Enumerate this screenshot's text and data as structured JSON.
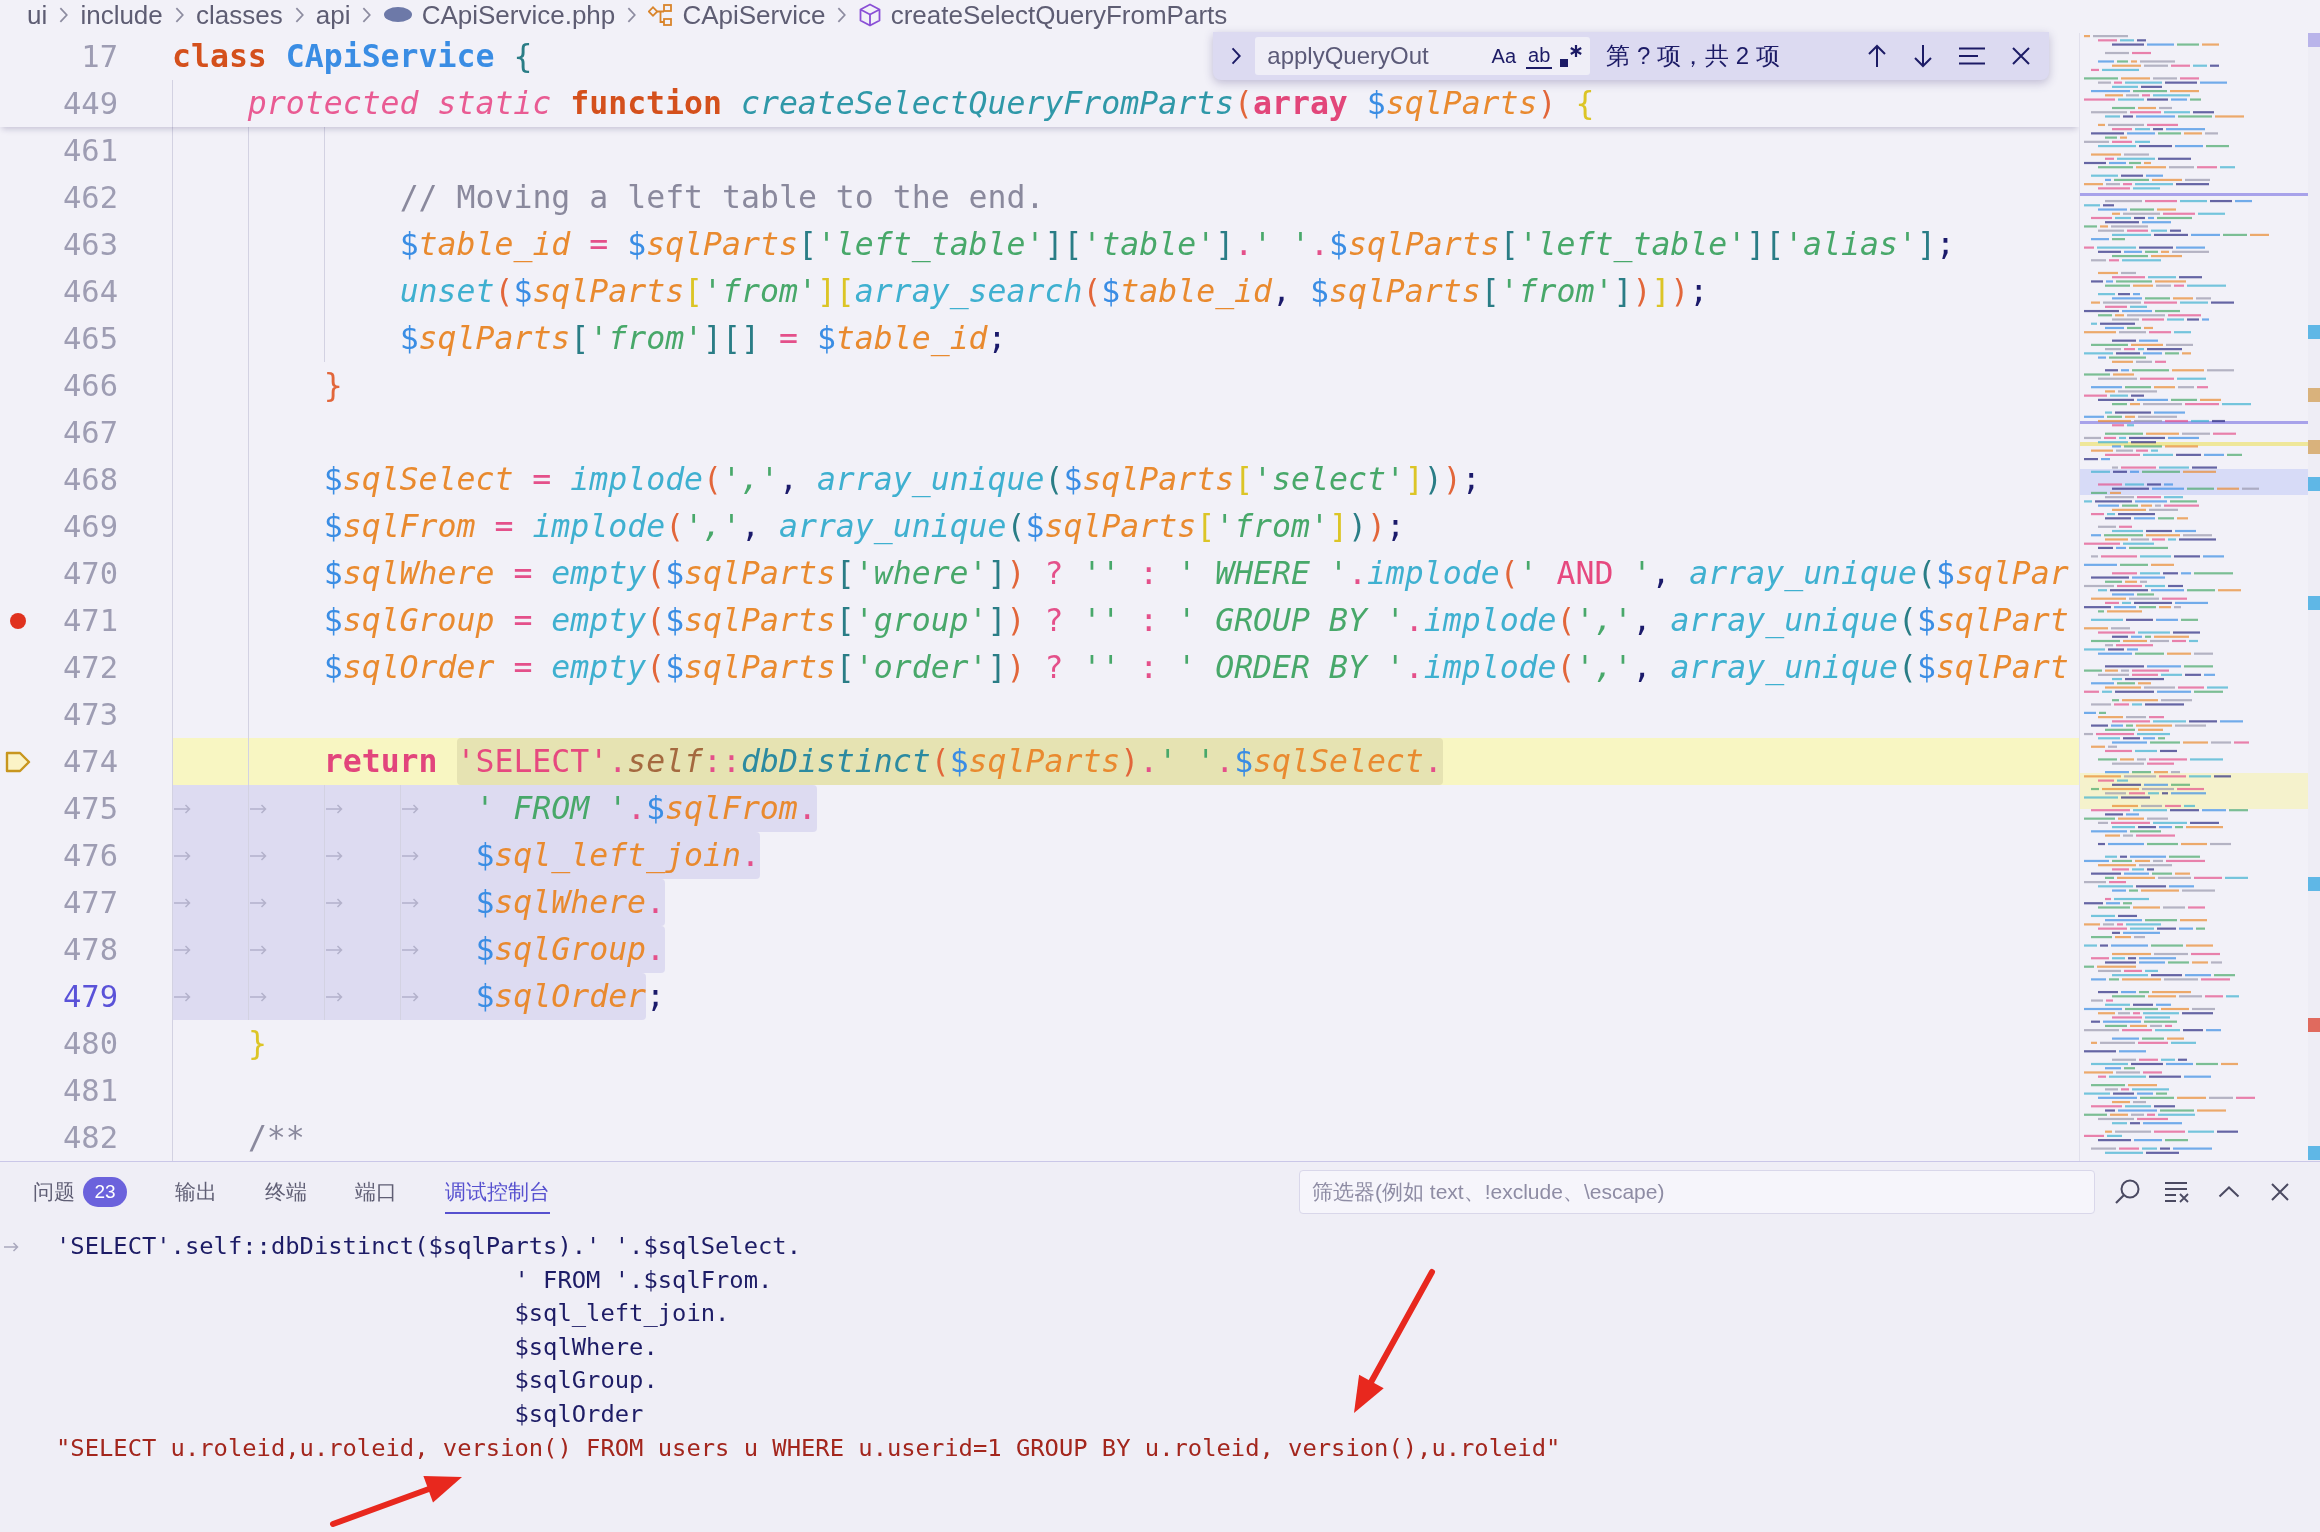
{
  "breadcrumb": [
    {
      "kind": "folder",
      "label": "ui"
    },
    {
      "kind": "folder",
      "label": "include"
    },
    {
      "kind": "folder",
      "label": "classes"
    },
    {
      "kind": "folder",
      "label": "api"
    },
    {
      "kind": "file",
      "label": "CApiService.php"
    },
    {
      "kind": "class",
      "label": "CApiService"
    },
    {
      "kind": "method",
      "label": "createSelectQueryFromParts"
    }
  ],
  "find_widget": {
    "value": "applyQueryOut",
    "options": [
      {
        "kind": "match-case",
        "label": "Aa"
      },
      {
        "kind": "whole-word",
        "label": "ab"
      },
      {
        "kind": "regex"
      }
    ],
    "result": "第 ? 项，共 2 项"
  },
  "editor": {
    "sticky_lines": [
      {
        "number": "17",
        "tokens": [
          {
            "text": "class ",
            "kind": "keyword"
          },
          {
            "text": "CApiService ",
            "kind": "class-name"
          },
          {
            "text": "{",
            "kind": "bracket-2"
          }
        ]
      },
      {
        "number": "449",
        "tokens": [
          {
            "text": "    protected static ",
            "kind": "modifier"
          },
          {
            "text": "function ",
            "kind": "keyword"
          },
          {
            "text": "createSelectQueryFromParts",
            "kind": "function-name"
          },
          {
            "text": "(",
            "kind": "bracket-1"
          },
          {
            "text": "array ",
            "kind": "type"
          },
          {
            "text": "$sqlParts",
            "kind": "variable"
          },
          {
            "text": ") ",
            "kind": "bracket-1"
          },
          {
            "text": "{",
            "kind": "bracket-3"
          }
        ]
      }
    ],
    "lines": [
      {
        "number": "461",
        "breakpoint": false,
        "paused": false,
        "cursor": false
      },
      {
        "number": "462",
        "breakpoint": false,
        "paused": false,
        "cursor": false,
        "parts": [
          {
            "selected": false,
            "tokens": [
              {
                "text": "            // Moving a left table to the end.",
                "kind": "comment"
              }
            ]
          }
        ]
      },
      {
        "number": "463",
        "breakpoint": false,
        "paused": false,
        "cursor": false,
        "parts": [
          {
            "selected": false,
            "tokens": [
              {
                "text": "            $table_id",
                "kind": "variable"
              },
              {
                "text": " = ",
                "kind": "operator"
              },
              {
                "text": "$sqlParts",
                "kind": "variable"
              },
              {
                "text": "[",
                "kind": "bracket-2"
              },
              {
                "text": "'left_table'",
                "kind": "string"
              },
              {
                "text": "][",
                "kind": "bracket-2"
              },
              {
                "text": "'table'",
                "kind": "string"
              },
              {
                "text": "]",
                "kind": "bracket-2"
              },
              {
                "text": ".",
                "kind": "operator"
              },
              {
                "text": "' '",
                "kind": "string"
              },
              {
                "text": ".",
                "kind": "operator"
              },
              {
                "text": "$sqlParts",
                "kind": "variable"
              },
              {
                "text": "[",
                "kind": "bracket-2"
              },
              {
                "text": "'left_table'",
                "kind": "string"
              },
              {
                "text": "][",
                "kind": "bracket-2"
              },
              {
                "text": "'alias'",
                "kind": "string"
              },
              {
                "text": "]",
                "kind": "bracket-2"
              },
              {
                "text": ";",
                "kind": "punctuation"
              }
            ]
          }
        ]
      },
      {
        "number": "464",
        "breakpoint": false,
        "paused": false,
        "cursor": false,
        "parts": [
          {
            "selected": false,
            "tokens": [
              {
                "text": "            unset",
                "kind": "call"
              },
              {
                "text": "(",
                "kind": "bracket-1"
              },
              {
                "text": "$sqlParts",
                "kind": "variable"
              },
              {
                "text": "[",
                "kind": "bracket-3"
              },
              {
                "text": "'from'",
                "kind": "string"
              },
              {
                "text": "][",
                "kind": "bracket-3"
              },
              {
                "text": "array_search",
                "kind": "call"
              },
              {
                "text": "(",
                "kind": "bracket-1"
              },
              {
                "text": "$table_id",
                "kind": "variable"
              },
              {
                "text": ", ",
                "kind": "punctuation"
              },
              {
                "text": "$sqlParts",
                "kind": "variable"
              },
              {
                "text": "[",
                "kind": "bracket-2"
              },
              {
                "text": "'from'",
                "kind": "string"
              },
              {
                "text": "]",
                "kind": "bracket-2"
              },
              {
                "text": ")",
                "kind": "bracket-1"
              },
              {
                "text": "]",
                "kind": "bracket-3"
              },
              {
                "text": ")",
                "kind": "bracket-1"
              },
              {
                "text": ";",
                "kind": "punctuation"
              }
            ]
          }
        ]
      },
      {
        "number": "465",
        "breakpoint": false,
        "paused": false,
        "cursor": false,
        "parts": [
          {
            "selected": false,
            "tokens": [
              {
                "text": "            $sqlParts",
                "kind": "variable"
              },
              {
                "text": "[",
                "kind": "bracket-2"
              },
              {
                "text": "'from'",
                "kind": "string"
              },
              {
                "text": "][]",
                "kind": "bracket-2"
              },
              {
                "text": " = ",
                "kind": "operator"
              },
              {
                "text": "$table_id",
                "kind": "variable"
              },
              {
                "text": ";",
                "kind": "punctuation"
              }
            ]
          }
        ]
      },
      {
        "number": "466",
        "breakpoint": false,
        "paused": false,
        "cursor": false,
        "parts": [
          {
            "selected": false,
            "tokens": [
              {
                "text": "        }",
                "kind": "bracket-1"
              }
            ]
          }
        ]
      },
      {
        "number": "467",
        "breakpoint": false,
        "paused": false,
        "cursor": false
      },
      {
        "number": "468",
        "breakpoint": false,
        "paused": false,
        "cursor": false,
        "parts": [
          {
            "selected": false,
            "tokens": [
              {
                "text": "        $sqlSelect",
                "kind": "variable"
              },
              {
                "text": " = ",
                "kind": "operator"
              },
              {
                "text": "implode",
                "kind": "call"
              },
              {
                "text": "(",
                "kind": "bracket-1"
              },
              {
                "text": "','",
                "kind": "string"
              },
              {
                "text": ", ",
                "kind": "punctuation"
              },
              {
                "text": "array_unique",
                "kind": "call"
              },
              {
                "text": "(",
                "kind": "bracket-2"
              },
              {
                "text": "$sqlParts",
                "kind": "variable"
              },
              {
                "text": "[",
                "kind": "bracket-3"
              },
              {
                "text": "'select'",
                "kind": "string"
              },
              {
                "text": "]",
                "kind": "bracket-3"
              },
              {
                "text": ")",
                "kind": "bracket-2"
              },
              {
                "text": ")",
                "kind": "bracket-1"
              },
              {
                "text": ";",
                "kind": "punctuation"
              }
            ]
          }
        ]
      },
      {
        "number": "469",
        "breakpoint": false,
        "paused": false,
        "cursor": false,
        "parts": [
          {
            "selected": false,
            "tokens": [
              {
                "text": "        $sqlFrom",
                "kind": "variable"
              },
              {
                "text": " = ",
                "kind": "operator"
              },
              {
                "text": "implode",
                "kind": "call"
              },
              {
                "text": "(",
                "kind": "bracket-1"
              },
              {
                "text": "','",
                "kind": "string"
              },
              {
                "text": ", ",
                "kind": "punctuation"
              },
              {
                "text": "array_unique",
                "kind": "call"
              },
              {
                "text": "(",
                "kind": "bracket-2"
              },
              {
                "text": "$sqlParts",
                "kind": "variable"
              },
              {
                "text": "[",
                "kind": "bracket-3"
              },
              {
                "text": "'from'",
                "kind": "string"
              },
              {
                "text": "]",
                "kind": "bracket-3"
              },
              {
                "text": ")",
                "kind": "bracket-2"
              },
              {
                "text": ")",
                "kind": "bracket-1"
              },
              {
                "text": ";",
                "kind": "punctuation"
              }
            ]
          }
        ]
      },
      {
        "number": "470",
        "breakpoint": false,
        "paused": false,
        "cursor": false,
        "parts": [
          {
            "selected": false,
            "tokens": [
              {
                "text": "        $sqlWhere",
                "kind": "variable"
              },
              {
                "text": " = ",
                "kind": "operator"
              },
              {
                "text": "empty",
                "kind": "call"
              },
              {
                "text": "(",
                "kind": "bracket-1"
              },
              {
                "text": "$sqlParts",
                "kind": "variable"
              },
              {
                "text": "[",
                "kind": "bracket-2"
              },
              {
                "text": "'where'",
                "kind": "string"
              },
              {
                "text": "]",
                "kind": "bracket-2"
              },
              {
                "text": ")",
                "kind": "bracket-1"
              },
              {
                "text": " ? ",
                "kind": "operator"
              },
              {
                "text": "''",
                "kind": "string"
              },
              {
                "text": " : ",
                "kind": "operator"
              },
              {
                "text": "' WHERE '",
                "kind": "string"
              },
              {
                "text": ".",
                "kind": "operator"
              },
              {
                "text": "implode",
                "kind": "call"
              },
              {
                "text": "(",
                "kind": "bracket-1"
              },
              {
                "text": "' ",
                "kind": "string"
              },
              {
                "text": "AND",
                "kind": "sql"
              },
              {
                "text": " '",
                "kind": "string"
              },
              {
                "text": ", ",
                "kind": "punctuation"
              },
              {
                "text": "array_unique",
                "kind": "call"
              },
              {
                "text": "(",
                "kind": "bracket-2"
              },
              {
                "text": "$sqlPar",
                "kind": "variable"
              }
            ]
          }
        ]
      },
      {
        "number": "471",
        "breakpoint": true,
        "paused": false,
        "cursor": false,
        "parts": [
          {
            "selected": false,
            "tokens": [
              {
                "text": "        $sqlGroup",
                "kind": "variable"
              },
              {
                "text": " = ",
                "kind": "operator"
              },
              {
                "text": "empty",
                "kind": "call"
              },
              {
                "text": "(",
                "kind": "bracket-1"
              },
              {
                "text": "$sqlParts",
                "kind": "variable"
              },
              {
                "text": "[",
                "kind": "bracket-2"
              },
              {
                "text": "'group'",
                "kind": "string"
              },
              {
                "text": "]",
                "kind": "bracket-2"
              },
              {
                "text": ")",
                "kind": "bracket-1"
              },
              {
                "text": " ? ",
                "kind": "operator"
              },
              {
                "text": "''",
                "kind": "string"
              },
              {
                "text": " : ",
                "kind": "operator"
              },
              {
                "text": "' GROUP BY '",
                "kind": "string"
              },
              {
                "text": ".",
                "kind": "operator"
              },
              {
                "text": "implode",
                "kind": "call"
              },
              {
                "text": "(",
                "kind": "bracket-1"
              },
              {
                "text": "','",
                "kind": "string"
              },
              {
                "text": ", ",
                "kind": "punctuation"
              },
              {
                "text": "array_unique",
                "kind": "call"
              },
              {
                "text": "(",
                "kind": "bracket-2"
              },
              {
                "text": "$sqlPart",
                "kind": "variable"
              }
            ]
          }
        ]
      },
      {
        "number": "472",
        "breakpoint": false,
        "paused": false,
        "cursor": false,
        "parts": [
          {
            "selected": false,
            "tokens": [
              {
                "text": "        $sqlOrder",
                "kind": "variable"
              },
              {
                "text": " = ",
                "kind": "operator"
              },
              {
                "text": "empty",
                "kind": "call"
              },
              {
                "text": "(",
                "kind": "bracket-1"
              },
              {
                "text": "$sqlParts",
                "kind": "variable"
              },
              {
                "text": "[",
                "kind": "bracket-2"
              },
              {
                "text": "'order'",
                "kind": "string"
              },
              {
                "text": "]",
                "kind": "bracket-2"
              },
              {
                "text": ")",
                "kind": "bracket-1"
              },
              {
                "text": " ? ",
                "kind": "operator"
              },
              {
                "text": "''",
                "kind": "string"
              },
              {
                "text": " : ",
                "kind": "operator"
              },
              {
                "text": "' ORDER BY '",
                "kind": "string"
              },
              {
                "text": ".",
                "kind": "operator"
              },
              {
                "text": "implode",
                "kind": "call"
              },
              {
                "text": "(",
                "kind": "bracket-1"
              },
              {
                "text": "','",
                "kind": "string"
              },
              {
                "text": ", ",
                "kind": "punctuation"
              },
              {
                "text": "array_unique",
                "kind": "call"
              },
              {
                "text": "(",
                "kind": "bracket-2"
              },
              {
                "text": "$sqlPart",
                "kind": "variable"
              }
            ]
          }
        ]
      },
      {
        "number": "473",
        "breakpoint": false,
        "paused": false,
        "cursor": false
      },
      {
        "number": "474",
        "breakpoint": false,
        "paused": true,
        "cursor": false,
        "parts": [
          {
            "selected": false,
            "tokens": [
              {
                "text": "        return ",
                "kind": "return"
              }
            ]
          },
          {
            "selected": true,
            "tokens": [
              {
                "text": "'SELECT'",
                "kind": "sql"
              },
              {
                "text": ".",
                "kind": "operator"
              },
              {
                "text": "self",
                "kind": "self"
              },
              {
                "text": "::",
                "kind": "operator"
              },
              {
                "text": "dbDistinct",
                "kind": "method"
              },
              {
                "text": "(",
                "kind": "bracket-1"
              },
              {
                "text": "$sqlParts",
                "kind": "variable"
              },
              {
                "text": ")",
                "kind": "bracket-1"
              },
              {
                "text": ".",
                "kind": "operator"
              },
              {
                "text": "' '",
                "kind": "string"
              },
              {
                "text": ".",
                "kind": "operator"
              },
              {
                "text": "$sqlSelect",
                "kind": "variable"
              },
              {
                "text": ".",
                "kind": "operator"
              }
            ]
          }
        ]
      },
      {
        "number": "475",
        "breakpoint": false,
        "paused": false,
        "cursor": false,
        "parts": [
          {
            "selected": true,
            "tokens": [
              {
                "text": "\t\t\t\t' FROM '",
                "kind": "string"
              },
              {
                "text": ".",
                "kind": "operator"
              },
              {
                "text": "$sqlFrom",
                "kind": "variable"
              },
              {
                "text": ".",
                "kind": "operator"
              }
            ]
          }
        ]
      },
      {
        "number": "476",
        "breakpoint": false,
        "paused": false,
        "cursor": false,
        "parts": [
          {
            "selected": true,
            "tokens": [
              {
                "text": "\t\t\t\t$sql_left_join",
                "kind": "variable"
              },
              {
                "text": ".",
                "kind": "operator"
              }
            ]
          }
        ]
      },
      {
        "number": "477",
        "breakpoint": false,
        "paused": false,
        "cursor": false,
        "parts": [
          {
            "selected": true,
            "tokens": [
              {
                "text": "\t\t\t\t$sqlWhere",
                "kind": "variable"
              },
              {
                "text": ".",
                "kind": "operator"
              }
            ]
          }
        ]
      },
      {
        "number": "478",
        "breakpoint": false,
        "paused": false,
        "cursor": false,
        "parts": [
          {
            "selected": true,
            "tokens": [
              {
                "text": "\t\t\t\t$sqlGroup",
                "kind": "variable"
              },
              {
                "text": ".",
                "kind": "operator"
              }
            ]
          }
        ]
      },
      {
        "number": "479",
        "breakpoint": false,
        "paused": false,
        "cursor": true,
        "parts": [
          {
            "selected": true,
            "tokens": [
              {
                "text": "\t\t\t\t$sqlOrder",
                "kind": "variable"
              }
            ]
          },
          {
            "selected": false,
            "tokens": [
              {
                "text": ";",
                "kind": "punctuation"
              }
            ]
          }
        ]
      },
      {
        "number": "480",
        "breakpoint": false,
        "paused": false,
        "cursor": false,
        "parts": [
          {
            "selected": false,
            "tokens": [
              {
                "text": "    }",
                "kind": "bracket-3"
              }
            ]
          }
        ]
      },
      {
        "number": "481",
        "breakpoint": false,
        "paused": false,
        "cursor": false
      },
      {
        "number": "482",
        "breakpoint": false,
        "paused": false,
        "cursor": false,
        "parts": [
          {
            "selected": false,
            "tokens": [
              {
                "text": "    /**",
                "kind": "comment"
              }
            ]
          }
        ]
      }
    ]
  },
  "panel": {
    "tabs": [
      {
        "label": "问题",
        "badge": "23",
        "selected": false
      },
      {
        "label": "输出",
        "selected": false
      },
      {
        "label": "终端",
        "selected": false
      },
      {
        "label": "端口",
        "selected": false
      },
      {
        "label": "调试控制台",
        "selected": true
      }
    ],
    "filter": {
      "placeholder": "筛选器(例如 text、!exclude、\\escape)"
    },
    "console": [
      {
        "kind": "input",
        "text": "'SELECT'.self::dbDistinct($sqlParts).' '.$sqlSelect.\n\t\t\t\t' FROM '.$sqlFrom.\n\t\t\t\t$sql_left_join.\n\t\t\t\t$sqlWhere.\n\t\t\t\t$sqlGroup.\n\t\t\t\t$sqlOrder"
      },
      {
        "kind": "output",
        "text": "\"SELECT u.roleid,u.roleid, version() FROM users u WHERE u.userid=1 GROUP BY u.roleid, version(),u.roleid\""
      }
    ]
  }
}
